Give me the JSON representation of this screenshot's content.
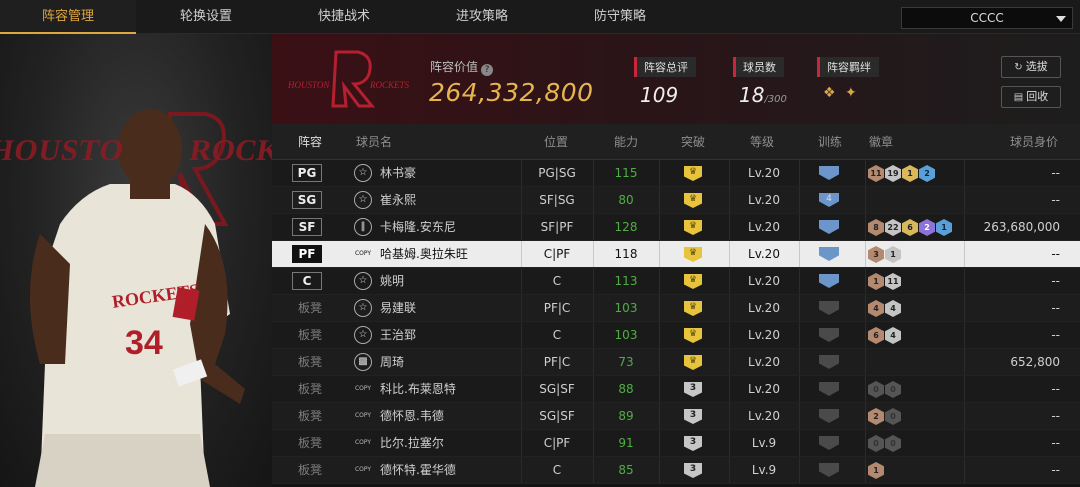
{
  "nav": {
    "tabs": [
      "阵容管理",
      "轮换设置",
      "快捷战术",
      "进攻策略",
      "防守策略"
    ],
    "active": 0,
    "team_select": "CCCC"
  },
  "header": {
    "team_logo_text": "HOUSTON ROCKETS",
    "value_label": "阵容价值",
    "value": "264,332,800",
    "rating_label": "阵容总评",
    "rating": "109",
    "players_label": "球员数",
    "players": "18",
    "players_max": "/300",
    "bond_label": "阵容羁绊",
    "buttons": {
      "select": "选拔",
      "recycle": "回收"
    }
  },
  "portrait": {
    "team_word_left": "HOUSTO",
    "team_word_right": "ROCK"
  },
  "table": {
    "headers": [
      "阵容",
      "球员名",
      "位置",
      "能力",
      "突破",
      "等级",
      "训练",
      "徽章",
      "球员身价"
    ],
    "rows": [
      {
        "slot": "PG",
        "bench": false,
        "type": "star",
        "name": "林书豪",
        "position": "PG|SG",
        "ability": "115",
        "green": true,
        "breakthrough": "crown",
        "level": "Lv.20",
        "train": "blue",
        "train_num": "",
        "badges": [
          [
            "bronze",
            "11"
          ],
          [
            "silver",
            "19"
          ],
          [
            "gold",
            "1"
          ],
          [
            "blue",
            "2"
          ]
        ],
        "value": "--"
      },
      {
        "slot": "SG",
        "bench": false,
        "type": "star",
        "name": "崔永熙",
        "position": "SF|SG",
        "ability": "80",
        "green": true,
        "breakthrough": "crown",
        "level": "Lv.20",
        "train": "blue",
        "train_num": "4",
        "badges": [],
        "value": "--"
      },
      {
        "slot": "SF",
        "bench": false,
        "type": "bar",
        "name": "卡梅隆.安东尼",
        "position": "SF|PF",
        "ability": "128",
        "green": true,
        "breakthrough": "crown",
        "level": "Lv.20",
        "train": "blue",
        "train_num": "",
        "badges": [
          [
            "bronze",
            "8"
          ],
          [
            "silver",
            "22"
          ],
          [
            "gold",
            "6"
          ],
          [
            "purple",
            "2"
          ],
          [
            "blue",
            "1"
          ]
        ],
        "value": "263,680,000"
      },
      {
        "slot": "PF",
        "bench": false,
        "selected": true,
        "type": "copy",
        "name": "哈基姆.奥拉朱旺",
        "position": "C|PF",
        "ability": "118",
        "green": false,
        "breakthrough": "crown",
        "level": "Lv.20",
        "train": "blue",
        "train_num": "",
        "badges": [
          [
            "bronze",
            "3"
          ],
          [
            "silver",
            "1"
          ]
        ],
        "value": "--"
      },
      {
        "slot": "C",
        "bench": false,
        "type": "star",
        "name": "姚明",
        "position": "C",
        "ability": "113",
        "green": true,
        "breakthrough": "crown",
        "level": "Lv.20",
        "train": "blue",
        "train_num": "",
        "badges": [
          [
            "bronze",
            "1"
          ],
          [
            "silver",
            "11"
          ]
        ],
        "value": "--"
      },
      {
        "slot": "板凳",
        "bench": true,
        "type": "star",
        "name": "易建联",
        "position": "PF|C",
        "ability": "103",
        "green": true,
        "breakthrough": "crown",
        "level": "Lv.20",
        "train": "dim",
        "train_num": "",
        "badges": [
          [
            "bronze",
            "4"
          ],
          [
            "silver",
            "4"
          ]
        ],
        "value": "--"
      },
      {
        "slot": "板凳",
        "bench": true,
        "type": "star",
        "name": "王治郅",
        "position": "C",
        "ability": "103",
        "green": true,
        "breakthrough": "crown",
        "level": "Lv.20",
        "train": "dim",
        "train_num": "",
        "badges": [
          [
            "bronze",
            "6"
          ],
          [
            "silver",
            "4"
          ]
        ],
        "value": "--"
      },
      {
        "slot": "板凳",
        "bench": true,
        "type": "bars",
        "name": "周琦",
        "position": "PF|C",
        "ability": "73",
        "green": true,
        "breakthrough": "crown",
        "level": "Lv.20",
        "train": "dim",
        "train_num": "",
        "badges": [],
        "value": "652,800"
      },
      {
        "slot": "板凳",
        "bench": true,
        "type": "copy",
        "name": "科比.布莱恩特",
        "position": "SG|SF",
        "ability": "88",
        "green": true,
        "breakthrough": "3",
        "level": "Lv.20",
        "train": "dim",
        "train_num": "",
        "badges": [
          [
            "dim",
            "0"
          ],
          [
            "dim",
            "0"
          ]
        ],
        "value": "--"
      },
      {
        "slot": "板凳",
        "bench": true,
        "type": "copy",
        "name": "德怀恩.韦德",
        "position": "SG|SF",
        "ability": "89",
        "green": true,
        "breakthrough": "3",
        "level": "Lv.20",
        "train": "dim",
        "train_num": "",
        "badges": [
          [
            "bronze",
            "2"
          ],
          [
            "dim",
            "0"
          ]
        ],
        "value": "--"
      },
      {
        "slot": "板凳",
        "bench": true,
        "type": "copy",
        "name": "比尔.拉塞尔",
        "position": "C|PF",
        "ability": "91",
        "green": true,
        "breakthrough": "3",
        "level": "Lv.9",
        "train": "dim",
        "train_num": "",
        "badges": [
          [
            "dim",
            "0"
          ],
          [
            "dim",
            "0"
          ]
        ],
        "value": "--"
      },
      {
        "slot": "板凳",
        "bench": true,
        "type": "copy",
        "name": "德怀特.霍华德",
        "position": "C",
        "ability": "85",
        "green": true,
        "breakthrough": "3",
        "level": "Lv.9",
        "train": "dim",
        "train_num": "",
        "badges": [
          [
            "bronze",
            "1"
          ]
        ],
        "value": "--"
      }
    ]
  }
}
